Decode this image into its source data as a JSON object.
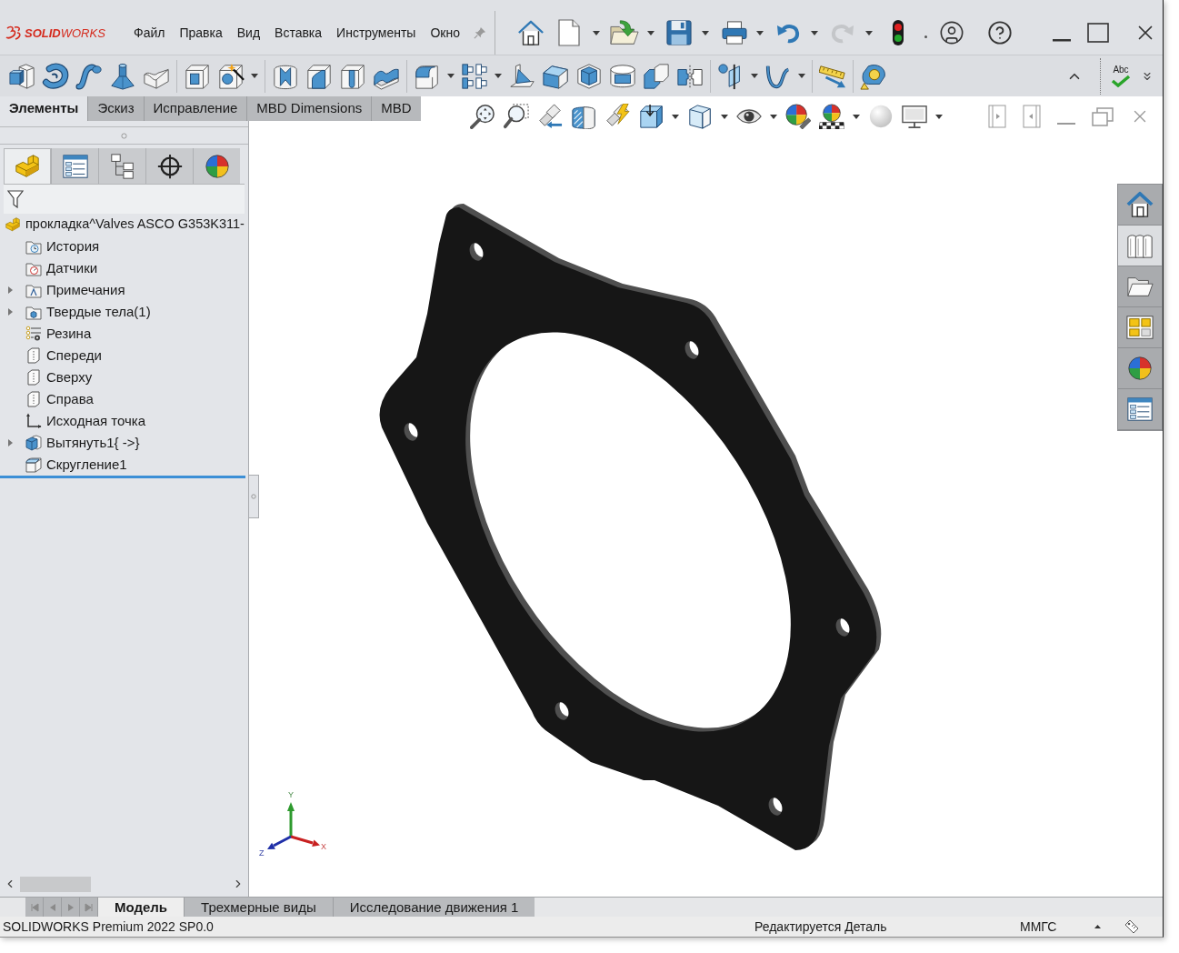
{
  "title_bar": {
    "logo": "**SOLID**WORKS",
    "menu": [
      "Файл",
      "Правка",
      "Вид",
      "Вставка",
      "Инструменты",
      "Окно"
    ]
  },
  "toolbar": {
    "spell_check": "Abc"
  },
  "command_tabs": [
    {
      "label": "Элементы",
      "selected": true
    },
    {
      "label": "Эскиз",
      "selected": false
    },
    {
      "label": "Исправление",
      "selected": false
    },
    {
      "label": "MBD Dimensions",
      "selected": false
    },
    {
      "label": "MBD",
      "selected": false
    }
  ],
  "panel_tabs": [
    {
      "kind": "features",
      "selected": true
    },
    {
      "kind": "properties",
      "selected": false
    },
    {
      "kind": "configurations",
      "selected": false
    },
    {
      "kind": "dimxpert",
      "selected": false
    },
    {
      "kind": "display",
      "selected": false
    }
  ],
  "feature_tree": {
    "root": "прокладка^Valves ASCO G353K311-",
    "items": [
      {
        "label": "История",
        "kind": "history",
        "expandable": false
      },
      {
        "label": "Датчики",
        "kind": "sensors",
        "expandable": false
      },
      {
        "label": "Примечания",
        "kind": "annotations",
        "expandable": true
      },
      {
        "label": "Твердые тела(1)",
        "kind": "bodies",
        "expandable": true
      },
      {
        "label": "Резина",
        "kind": "material",
        "expandable": false
      },
      {
        "label": "Спереди",
        "kind": "plane",
        "expandable": false
      },
      {
        "label": "Сверху",
        "kind": "plane",
        "expandable": false
      },
      {
        "label": "Справа",
        "kind": "plane",
        "expandable": false
      },
      {
        "label": "Исходная точка",
        "kind": "origin",
        "expandable": false
      },
      {
        "label": "Вытянуть1{ ->}",
        "kind": "extrude",
        "expandable": true
      },
      {
        "label": "Скругление1",
        "kind": "fillet",
        "expandable": false
      }
    ]
  },
  "triad": {
    "x": "X",
    "y": "Y",
    "z": "Z"
  },
  "task_pane": [
    {
      "kind": "home",
      "selected": false
    },
    {
      "kind": "library",
      "selected": true
    },
    {
      "kind": "files",
      "selected": false
    },
    {
      "kind": "palette",
      "selected": false
    },
    {
      "kind": "appearances",
      "selected": false
    },
    {
      "kind": "properties",
      "selected": false
    }
  ],
  "sheet_tabs": [
    {
      "label": "Модель",
      "selected": true
    },
    {
      "label": "Трехмерные виды",
      "selected": false
    },
    {
      "label": "Исследование движения 1",
      "selected": false
    }
  ],
  "status_bar": {
    "product": "SOLIDWORKS Premium 2022 SP0.0",
    "mode": "Редактируется Деталь",
    "units": "ММГС"
  }
}
